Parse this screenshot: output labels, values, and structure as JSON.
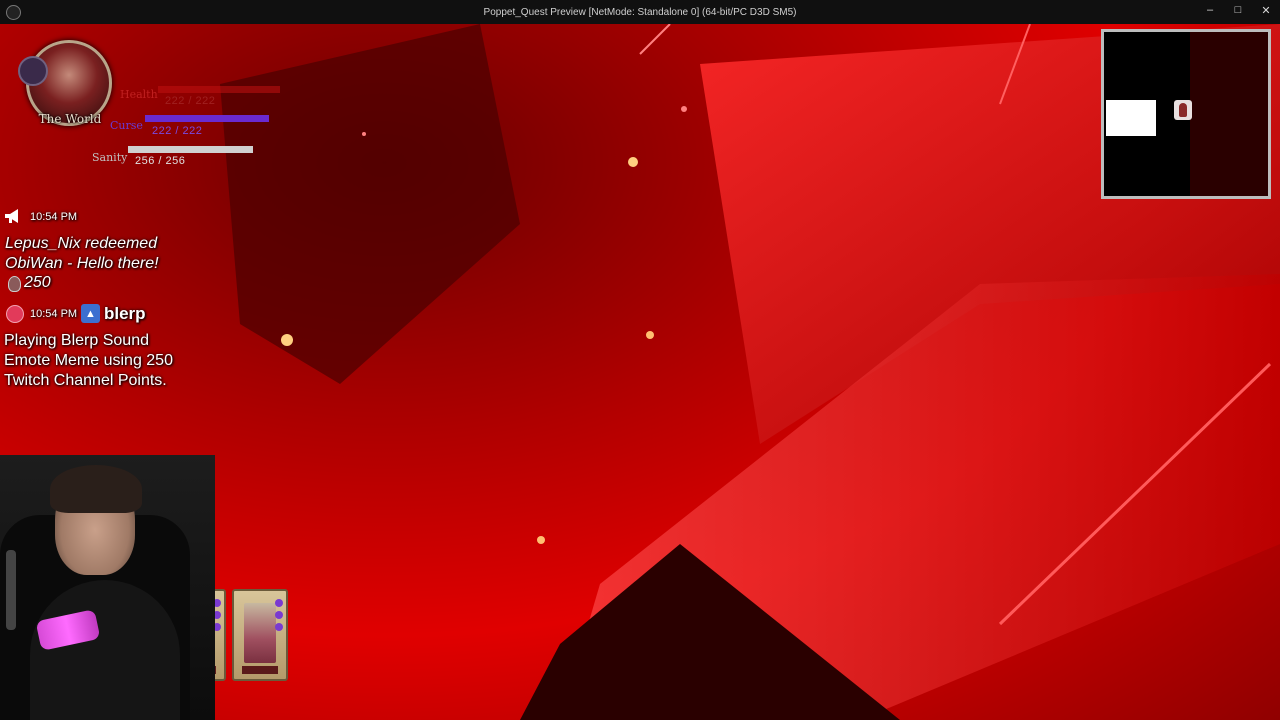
{
  "window": {
    "title": "Poppet_Quest Preview [NetMode: Standalone 0]  (64-bit/PC D3D SM5)",
    "controls": [
      "minimize",
      "maximize",
      "close"
    ]
  },
  "hud": {
    "portrait_title": "The World",
    "stats": [
      {
        "label": "Health",
        "value": "222 / 222",
        "color": "#c01010",
        "fill": 1.0
      },
      {
        "label": "Curse",
        "value": "222 / 222",
        "color": "#6a2ad0",
        "fill": 1.0
      },
      {
        "label": "Sanity",
        "value": "256 / 256",
        "color": "#d0d0d0",
        "fill": 1.0
      }
    ]
  },
  "chat": {
    "redeem": {
      "time": "10:54 PM",
      "line1": "Lepus_Nix redeemed",
      "line2": "ObiWan - Hello there!",
      "points": "250"
    },
    "blerp": {
      "time": "10:54 PM",
      "name": "blerp",
      "line1": "Playing Blerp Sound",
      "line2": "Emote Meme using 250",
      "line3": "Twitch Channel Points."
    }
  },
  "colors": {
    "background_red": "#d00000",
    "accent_magenta": "#e050e0"
  },
  "icons": {
    "megaphone": "megaphone-icon",
    "points": "channel-points-icon",
    "blerp": "blerp-icon"
  }
}
